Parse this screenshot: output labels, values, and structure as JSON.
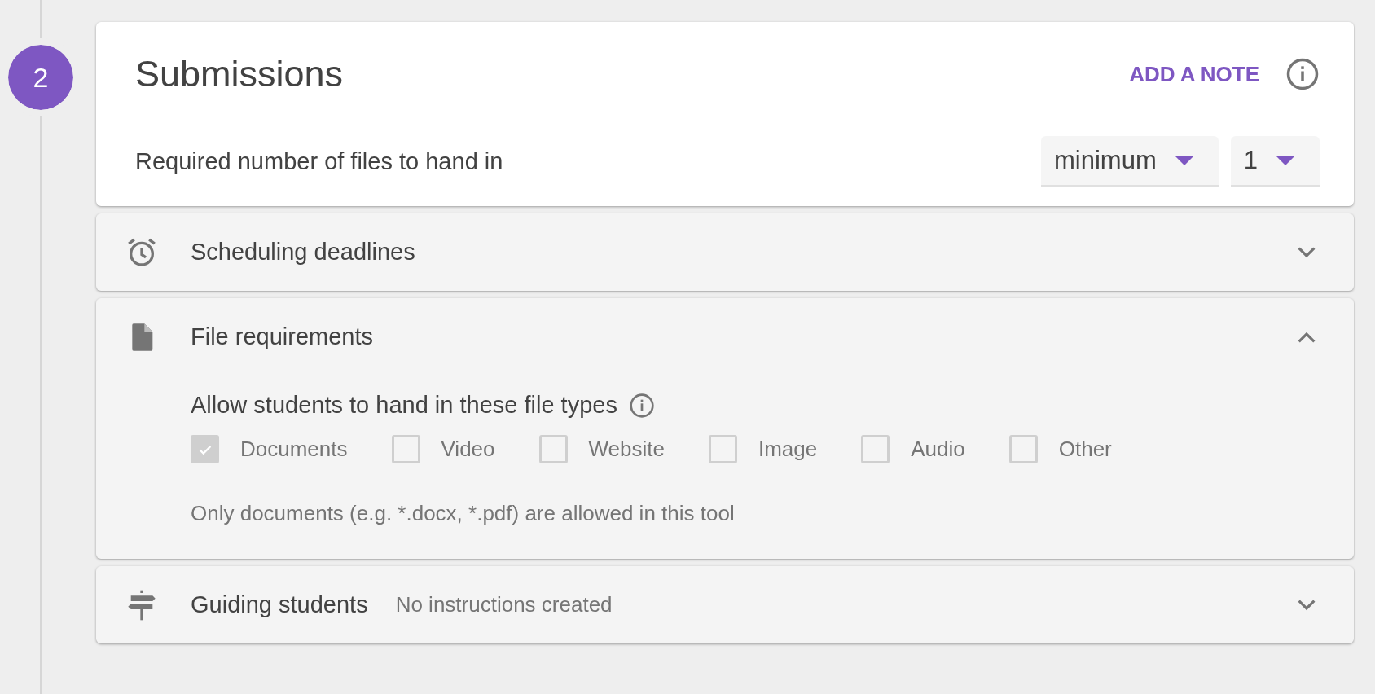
{
  "step": {
    "number": "2"
  },
  "header": {
    "title": "Submissions",
    "note_button": "ADD A NOTE",
    "setting_label": "Required number of files to hand in",
    "dropdowns": [
      {
        "value": "minimum"
      },
      {
        "value": "1"
      }
    ]
  },
  "sections": [
    {
      "kind": "clock",
      "title": "Scheduling deadlines",
      "expanded": false
    },
    {
      "kind": "file",
      "title": "File requirements",
      "expanded": true,
      "heading": "Allow students to hand in these file types",
      "options": [
        {
          "label": "Documents",
          "checked": true,
          "disabled": true
        },
        {
          "label": "Video",
          "checked": false,
          "disabled": true
        },
        {
          "label": "Website",
          "checked": false,
          "disabled": true
        },
        {
          "label": "Image",
          "checked": false,
          "disabled": true
        },
        {
          "label": "Audio",
          "checked": false,
          "disabled": true
        },
        {
          "label": "Other",
          "checked": false,
          "disabled": true
        }
      ],
      "hint": "Only documents (e.g. *.docx, *.pdf) are allowed in this tool"
    },
    {
      "kind": "signpost",
      "title": "Guiding students",
      "status": "No instructions created",
      "expanded": false
    }
  ]
}
